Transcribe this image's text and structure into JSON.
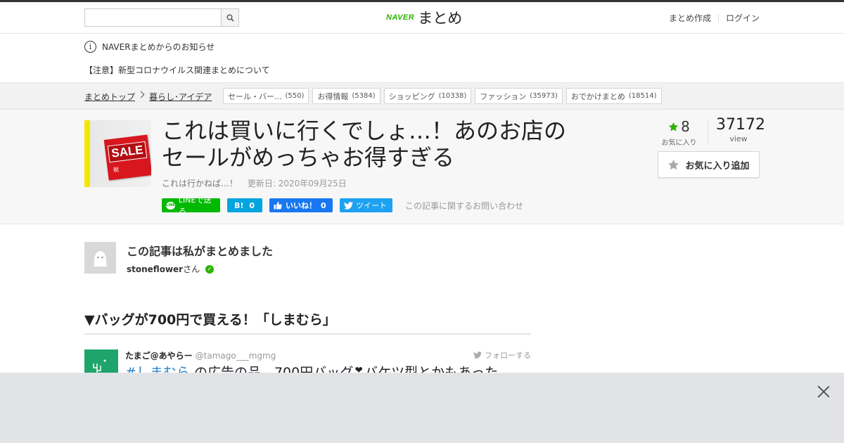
{
  "header": {
    "search_placeholder": "",
    "logo_brand": "NAVER",
    "logo_name": "まとめ",
    "create_link": "まとめ作成",
    "login_link": "ログイン"
  },
  "notice": {
    "heading": "NAVERまとめからのお知らせ",
    "link": "【注意】新型コロナウイルス関連まとめについて"
  },
  "breadcrumb": {
    "items": [
      "まとめトップ",
      "暮らし･アイデア"
    ],
    "tags": [
      {
        "label": "セール・バー...",
        "count": "(550)"
      },
      {
        "label": "お得情報",
        "count": "(5384)"
      },
      {
        "label": "ショッピング",
        "count": "(10338)"
      },
      {
        "label": "ファッション",
        "count": "(35973)"
      },
      {
        "label": "おでかけまとめ",
        "count": "(18514)"
      }
    ]
  },
  "article": {
    "thumb_sale": "SALE",
    "thumb_small": "税",
    "title_line1": "これは買いに行くでしょ…！あのお店の",
    "title_line2": "セールがめっちゃお得すぎる",
    "description": "これは行かねば…！",
    "updated": "更新日: 2020年09月25日",
    "fav_count": "8",
    "fav_label": "お気に入り",
    "view_count": "37172",
    "view_label": "view",
    "fav_button": "お気に入り追加",
    "contact_link": "この記事に関するお問い合わせ"
  },
  "social": {
    "line": "LINEで送る",
    "hatena_count": "0",
    "like_label": "いいね！",
    "like_count": "0",
    "tweet": "ツイート"
  },
  "author": {
    "heading": "この記事は私がまとめました",
    "name": "stoneflower",
    "suffix": "さん"
  },
  "section": {
    "heading": "▼バッグが700円で買える！「しまむら」"
  },
  "tweet": {
    "user": "たまご@あやらー",
    "handle": "@tamago___mgmg",
    "follow": "フォローする",
    "hashtag": "#しまむら",
    "text": " の広告の品、700円バッグ❣︎バケツ型とかもあった"
  },
  "colors": {
    "brand_green": "#2db400",
    "line_green": "#00b900",
    "hatena_blue": "#00a4de",
    "facebook_blue": "#1877f2",
    "twitter_blue": "#1da1f2",
    "sale_red": "#d8161d"
  }
}
